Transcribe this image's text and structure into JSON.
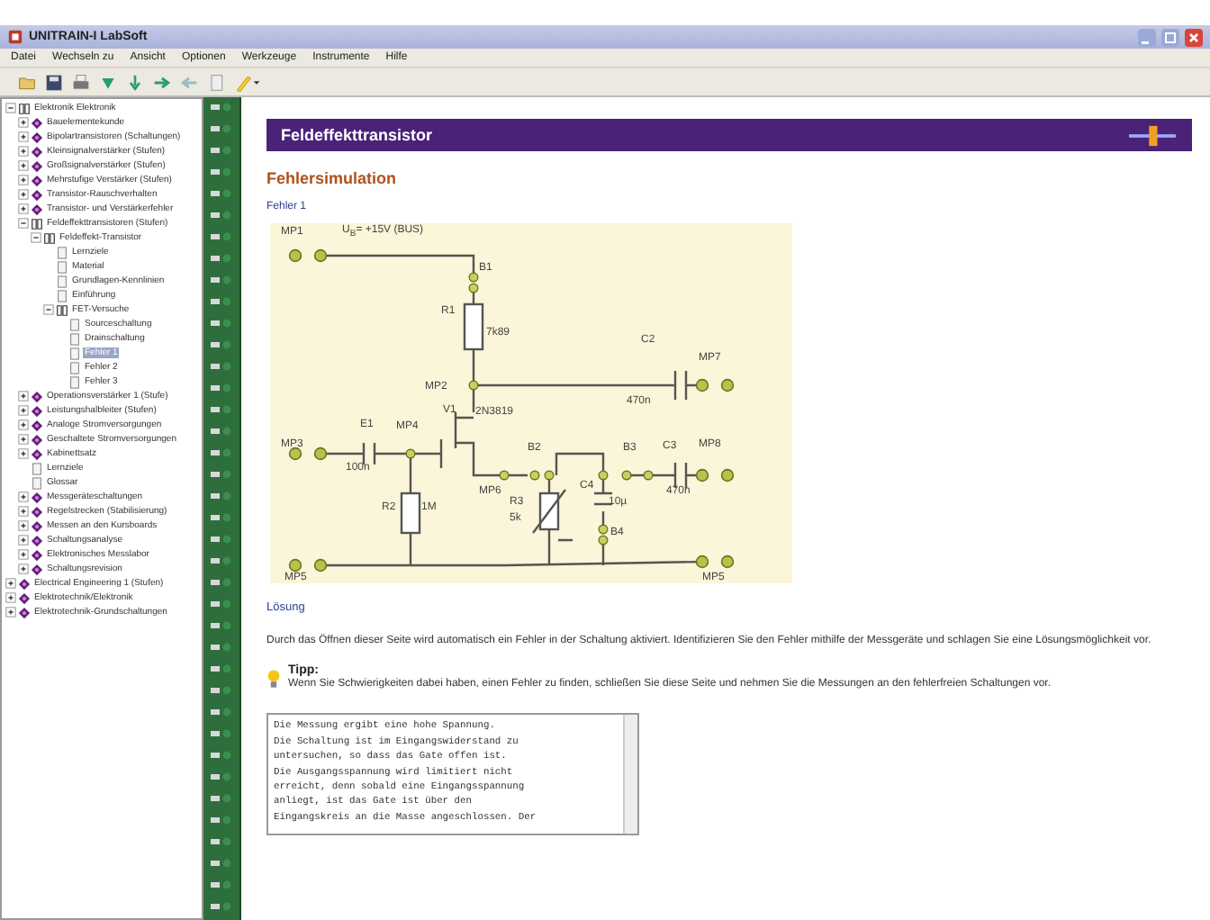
{
  "window": {
    "title": "UNITRAIN-I LabSoft"
  },
  "menu": [
    "Datei",
    "Wechseln zu",
    "Ansicht",
    "Optionen",
    "Werkzeuge",
    "Instrumente",
    "Hilfe"
  ],
  "sidebar": {
    "tree": [
      {
        "label": "Elektronik Elektronik",
        "kind": "folder",
        "expanded": true,
        "selected": false,
        "children": [
          {
            "label": "Bauelementekunde",
            "kind": "course",
            "expanded": false,
            "selected": false
          },
          {
            "label": "Bipolartransistoren (Schaltungen)",
            "kind": "course",
            "expanded": false,
            "selected": false
          },
          {
            "label": "Kleinsignalverstärker (Stufen)",
            "kind": "course",
            "expanded": false,
            "selected": false
          },
          {
            "label": "Großsignalverstärker (Stufen)",
            "kind": "course",
            "expanded": false,
            "selected": false
          },
          {
            "label": "Mehrstufige Verstärker (Stufen)",
            "kind": "course",
            "expanded": false,
            "selected": false
          },
          {
            "label": "Transistor-Rauschverhalten",
            "kind": "course",
            "expanded": false,
            "selected": false
          },
          {
            "label": "Transistor- und Verstärkerfehler",
            "kind": "course",
            "expanded": false,
            "selected": false
          },
          {
            "label": "Feldeffekttransistoren (Stufen)",
            "kind": "folder",
            "expanded": true,
            "selected": false,
            "children": [
              {
                "label": "Feldeffekt-Transistor",
                "kind": "folder",
                "expanded": true,
                "selected": false,
                "children": [
                  {
                    "label": "Lernziele",
                    "kind": "page",
                    "selected": false
                  },
                  {
                    "label": "Material",
                    "kind": "page",
                    "selected": false
                  },
                  {
                    "label": "Grundlagen-Kennlinien",
                    "kind": "page",
                    "selected": false
                  },
                  {
                    "label": "Einführung",
                    "kind": "page",
                    "selected": false
                  },
                  {
                    "label": "FET-Versuche",
                    "kind": "folder",
                    "expanded": true,
                    "selected": false,
                    "children": [
                      {
                        "label": "Sourceschaltung",
                        "kind": "page",
                        "selected": false
                      },
                      {
                        "label": "Drainschaltung",
                        "kind": "page",
                        "selected": false
                      },
                      {
                        "label": "Fehler 1",
                        "kind": "page",
                        "selected": true
                      },
                      {
                        "label": "Fehler 2",
                        "kind": "page",
                        "selected": false
                      },
                      {
                        "label": "Fehler 3",
                        "kind": "page",
                        "selected": false
                      }
                    ]
                  }
                ]
              }
            ]
          },
          {
            "label": "Operationsverstärker 1 (Stufe)",
            "kind": "course",
            "expanded": false,
            "selected": false
          },
          {
            "label": "Leistungshalbleiter (Stufen)",
            "kind": "course",
            "expanded": false,
            "selected": false
          },
          {
            "label": "Analoge Stromversorgungen",
            "kind": "course",
            "expanded": false,
            "selected": false
          },
          {
            "label": "Geschaltete Stromversorgungen",
            "kind": "course",
            "expanded": false,
            "selected": false
          },
          {
            "label": "Kabinettsatz",
            "kind": "course",
            "expanded": false,
            "selected": false
          },
          {
            "label": "Lernziele",
            "kind": "page",
            "selected": false
          },
          {
            "label": "Glossar",
            "kind": "page",
            "selected": false
          },
          {
            "label": "Messgeräteschaltungen",
            "kind": "course",
            "expanded": false,
            "selected": false
          },
          {
            "label": "Regelstrecken (Stabilisierung)",
            "kind": "course",
            "expanded": false,
            "selected": false
          },
          {
            "label": "Messen an den Kursboards",
            "kind": "course",
            "expanded": false,
            "selected": false
          },
          {
            "label": "Schaltungsanalyse",
            "kind": "course",
            "expanded": false,
            "selected": false
          },
          {
            "label": "Elektronisches Messlabor",
            "kind": "course",
            "expanded": false,
            "selected": false
          },
          {
            "label": "Schaltungsrevision",
            "kind": "course",
            "expanded": false,
            "selected": false
          }
        ]
      },
      {
        "label": "Electrical Engineering 1 (Stufen)",
        "kind": "course",
        "expanded": false,
        "selected": false
      },
      {
        "label": "Elektrotechnik/Elektronik",
        "kind": "course",
        "expanded": false,
        "selected": false
      },
      {
        "label": "Elektrotechnik-Grundschaltungen",
        "kind": "course",
        "expanded": false,
        "selected": false
      }
    ]
  },
  "page": {
    "header": "Feldeffekttransistor",
    "heading": "Fehlersimulation",
    "subheading": "Fehler 1",
    "circuit": {
      "labels": [
        "MP1",
        "U$_{B}$= +15V (BUS)",
        "B1",
        "R1",
        "7k89",
        "MP2",
        "C2",
        "470n",
        "MP7",
        "V1",
        "2N3819",
        "MP3",
        "E1",
        "100n",
        "MP4",
        "R2",
        "1M",
        "MP6",
        "B2",
        "R3",
        "5k",
        "C4",
        "10µ",
        "B3",
        "C3",
        "470n",
        "MP8",
        "B4",
        "MP5",
        "MP5"
      ]
    },
    "solution_link": "Lösung",
    "intro": "Durch das Öffnen dieser Seite wird automatisch ein Fehler in der Schaltung aktiviert. Identifizieren Sie den Fehler mithilfe der Messgeräte und schlagen Sie eine Lösungsmöglichkeit vor.",
    "tip": {
      "title": "Tipp:",
      "text": "Wenn Sie Schwierigkeiten dabei haben, einen Fehler zu finden, schließen Sie diese Seite und nehmen Sie die Messungen an den fehlerfreien Schaltungen vor."
    },
    "answer": "Die Messung ergibt eine hohe Spannung.\nDie Schaltung ist im Eingangswiderstand zu\nuntersuchen, so dass das Gate offen ist.\nDie Ausgangsspannung wird limitiert nicht\nerreicht, denn sobald eine Eingangsspannung\nanliegt, ist das Gate ist über den\nEingangskreis an die Masse angeschlossen. Der"
  }
}
